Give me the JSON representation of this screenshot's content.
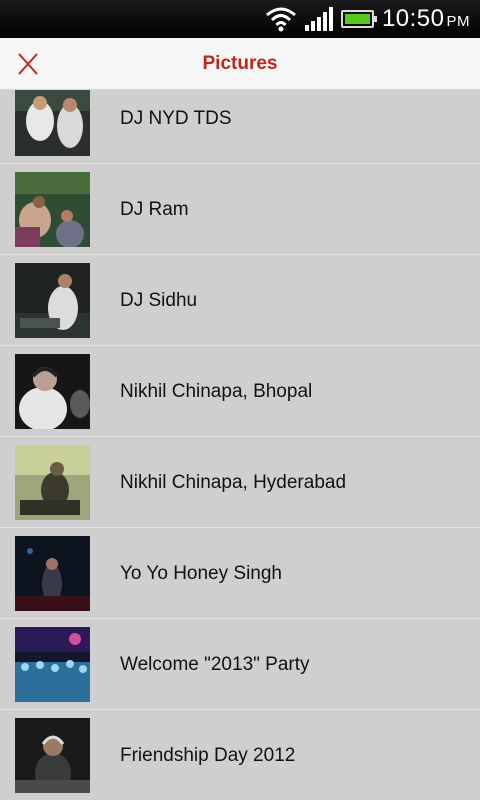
{
  "status_bar": {
    "time": "10:50",
    "ampm": "PM"
  },
  "header": {
    "title": "Pictures"
  },
  "albums": [
    {
      "label": "DJ NYD TDS"
    },
    {
      "label": "DJ Ram"
    },
    {
      "label": "DJ Sidhu"
    },
    {
      "label": "Nikhil Chinapa, Bhopal"
    },
    {
      "label": "Nikhil Chinapa, Hyderabad"
    },
    {
      "label": "Yo Yo Honey Singh"
    },
    {
      "label": "Welcome \"2013\" Party"
    },
    {
      "label": "Friendship Day 2012"
    }
  ]
}
